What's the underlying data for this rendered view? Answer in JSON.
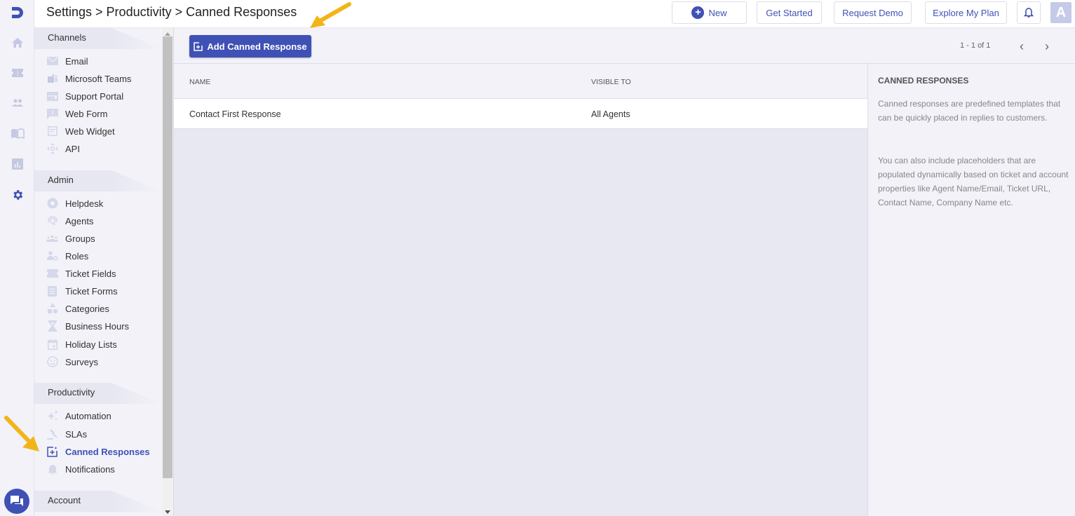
{
  "header": {
    "breadcrumb": "Settings > Productivity > Canned Responses",
    "buttons": {
      "new": "New",
      "get_started": "Get Started",
      "request_demo": "Request Demo",
      "explore_plan": "Explore My Plan"
    },
    "avatar_initial": "A"
  },
  "rail": {
    "icons": [
      "home-icon",
      "tickets-icon",
      "contacts-icon",
      "knowledge-base-icon",
      "reports-icon",
      "settings-icon"
    ],
    "active": "settings-icon"
  },
  "sidebar": {
    "sections": [
      {
        "title": "Channels",
        "items": [
          "Email",
          "Microsoft Teams",
          "Support Portal",
          "Web Form",
          "Web Widget",
          "API"
        ]
      },
      {
        "title": "Admin",
        "items": [
          "Helpdesk",
          "Agents",
          "Groups",
          "Roles",
          "Ticket Fields",
          "Ticket Forms",
          "Categories",
          "Business Hours",
          "Holiday Lists",
          "Surveys"
        ]
      },
      {
        "title": "Productivity",
        "items": [
          "Automation",
          "SLAs",
          "Canned Responses",
          "Notifications"
        ]
      },
      {
        "title": "Account",
        "items": []
      }
    ],
    "active_item": "Canned Responses"
  },
  "main": {
    "add_button": "Add Canned Response",
    "pagination": "1 - 1 of 1",
    "columns": [
      "NAME",
      "VISIBLE TO"
    ],
    "rows": [
      {
        "name": "Contact First Response",
        "visible_to": "All Agents"
      }
    ]
  },
  "info_panel": {
    "title": "CANNED RESPONSES",
    "paragraph1": "Canned responses are predefined templates that can be quickly placed in replies to customers.",
    "paragraph2": "You can also include placeholders that are populated dynamically based on ticket and account properties like Agent Name/Email, Ticket URL, Contact Name, Company Name etc."
  },
  "colors": {
    "accent": "#3f51b5",
    "annotation_arrow": "#f2b418"
  }
}
